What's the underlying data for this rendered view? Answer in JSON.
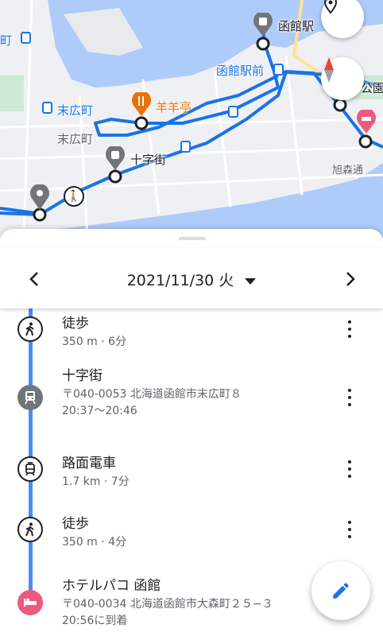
{
  "map": {
    "labels": {
      "station": "函館駅",
      "station_front": "函館駅前",
      "suehirocho_stop": "末広町",
      "suehirocho_area": "末広町",
      "restaurant": "羊羊亭",
      "jujigai": "十字街",
      "park": "公園",
      "asahimoridori": "旭森通",
      "left_edge": "町"
    },
    "colors": {
      "water": "#aecbfa",
      "route": "#1a73e8",
      "land": "#eef0f3"
    },
    "icons": [
      "pin-icon",
      "compass-icon",
      "train-icon",
      "restaurant-icon",
      "walk-icon",
      "hotel-icon",
      "tram-stop-icon"
    ]
  },
  "sheet": {
    "date": "2021/11/30 火",
    "prev_icon": "chevron-left-icon",
    "next_icon": "chevron-right-icon",
    "dropdown_icon": "arrow-drop-down-icon"
  },
  "timeline": [
    {
      "type": "walk",
      "icon": "walk-icon",
      "title": "徒歩",
      "sub1": "350 m · 6分",
      "sub2": ""
    },
    {
      "type": "place",
      "icon": "train-icon",
      "title": "十字街",
      "sub1": "〒040-0053 北海道函館市末広町８",
      "sub2": "20:37〜20:46"
    },
    {
      "type": "tram",
      "icon": "tram-icon",
      "title": "路面電車",
      "sub1": "1.7 km · 7分",
      "sub2": ""
    },
    {
      "type": "walk",
      "icon": "walk-icon",
      "title": "徒歩",
      "sub1": "350 m · 4分",
      "sub2": ""
    },
    {
      "type": "hotel",
      "icon": "hotel-icon",
      "title": "ホテルパコ 函館",
      "sub1": "〒040-0034 北海道函館市大森町２５−３",
      "sub2": "20:56に到着"
    }
  ],
  "edit_icon": "edit-pencil-icon"
}
